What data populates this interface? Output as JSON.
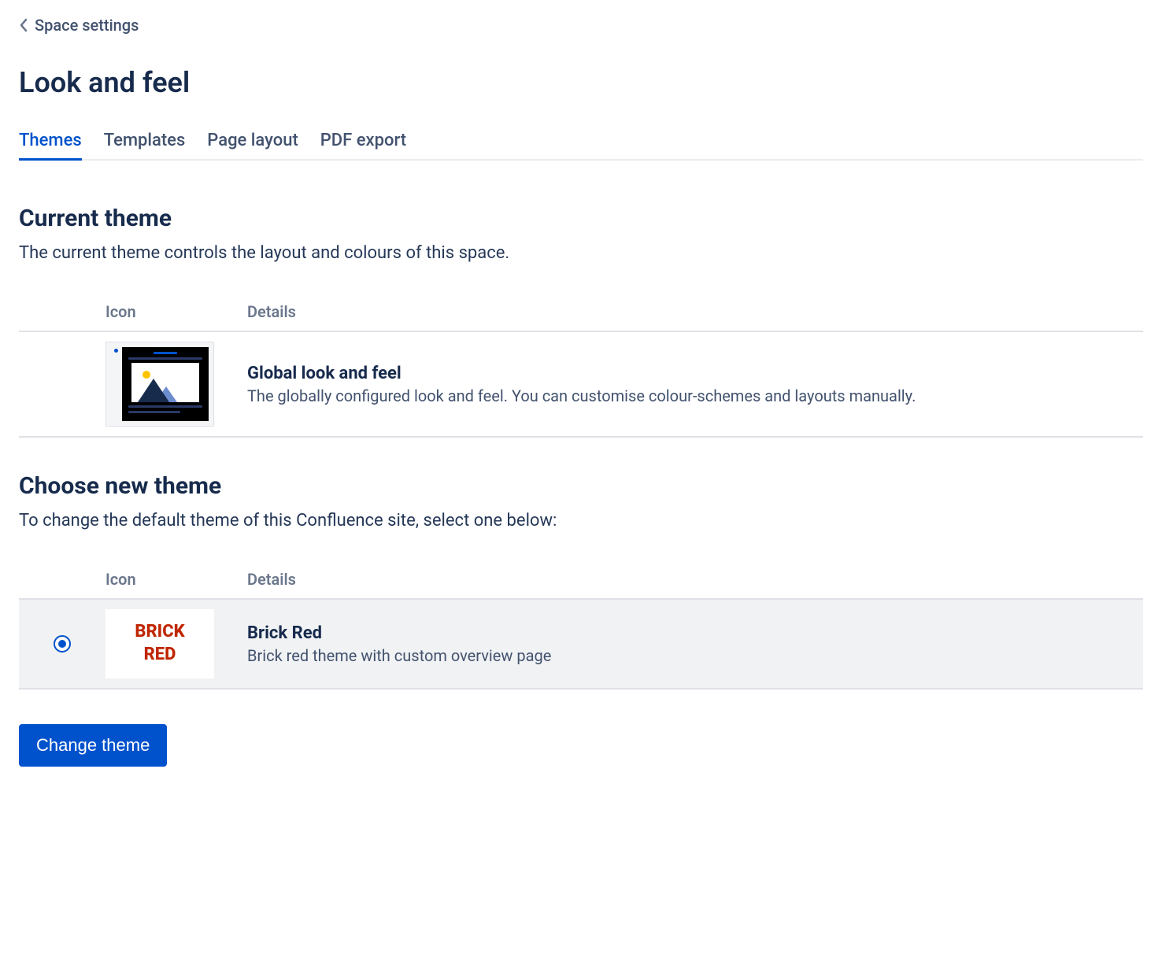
{
  "breadcrumb": {
    "label": "Space settings"
  },
  "page_title": "Look and feel",
  "tabs": [
    {
      "label": "Themes",
      "active": true
    },
    {
      "label": "Templates",
      "active": false
    },
    {
      "label": "Page layout",
      "active": false
    },
    {
      "label": "PDF export",
      "active": false
    }
  ],
  "current_theme_section": {
    "title": "Current theme",
    "description": "The current theme controls the layout and colours of this space.",
    "columns": {
      "icon": "Icon",
      "details": "Details"
    },
    "theme": {
      "name": "Global look and feel",
      "description": "The globally configured look and feel. You can customise colour-schemes and layouts manually.",
      "icon": "global-theme-thumbnail"
    }
  },
  "choose_theme_section": {
    "title": "Choose new theme",
    "description": "To change the default theme of this Confluence site, select one below:",
    "columns": {
      "icon": "Icon",
      "details": "Details"
    },
    "themes": [
      {
        "name": "Brick Red",
        "description": "Brick red theme with custom overview page",
        "icon": "brick-red-thumbnail",
        "icon_text_line1": "BRICK",
        "icon_text_line2": "RED",
        "selected": true
      }
    ]
  },
  "actions": {
    "change_theme": "Change theme"
  },
  "colors": {
    "primary": "#0052CC",
    "text": "#172B4D",
    "brick": "#BF2600"
  }
}
